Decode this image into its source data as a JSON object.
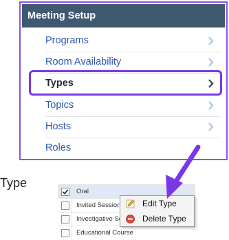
{
  "menu": {
    "header": "Meeting Setup",
    "items": [
      {
        "label": "Programs"
      },
      {
        "label": "Room Availability"
      },
      {
        "label": "Types"
      },
      {
        "label": "Topics"
      },
      {
        "label": "Hosts"
      },
      {
        "label": "Roles"
      }
    ]
  },
  "caption": "Type",
  "list": {
    "rows": [
      {
        "label": "Oral",
        "checked": true
      },
      {
        "label": "Invited Session",
        "checked": false
      },
      {
        "label": "Investigative Session",
        "checked": false
      },
      {
        "label": "Educational Course",
        "checked": false
      }
    ]
  },
  "context_menu": {
    "items": [
      {
        "label": "Edit Type",
        "icon": "pencil-icon"
      },
      {
        "label": "Delete Type",
        "icon": "delete-icon"
      }
    ]
  },
  "colors": {
    "header_bg": "#3f5971",
    "link": "#2e57b4",
    "highlight": "#7a38e8",
    "chevron": "#a9c4e8"
  }
}
